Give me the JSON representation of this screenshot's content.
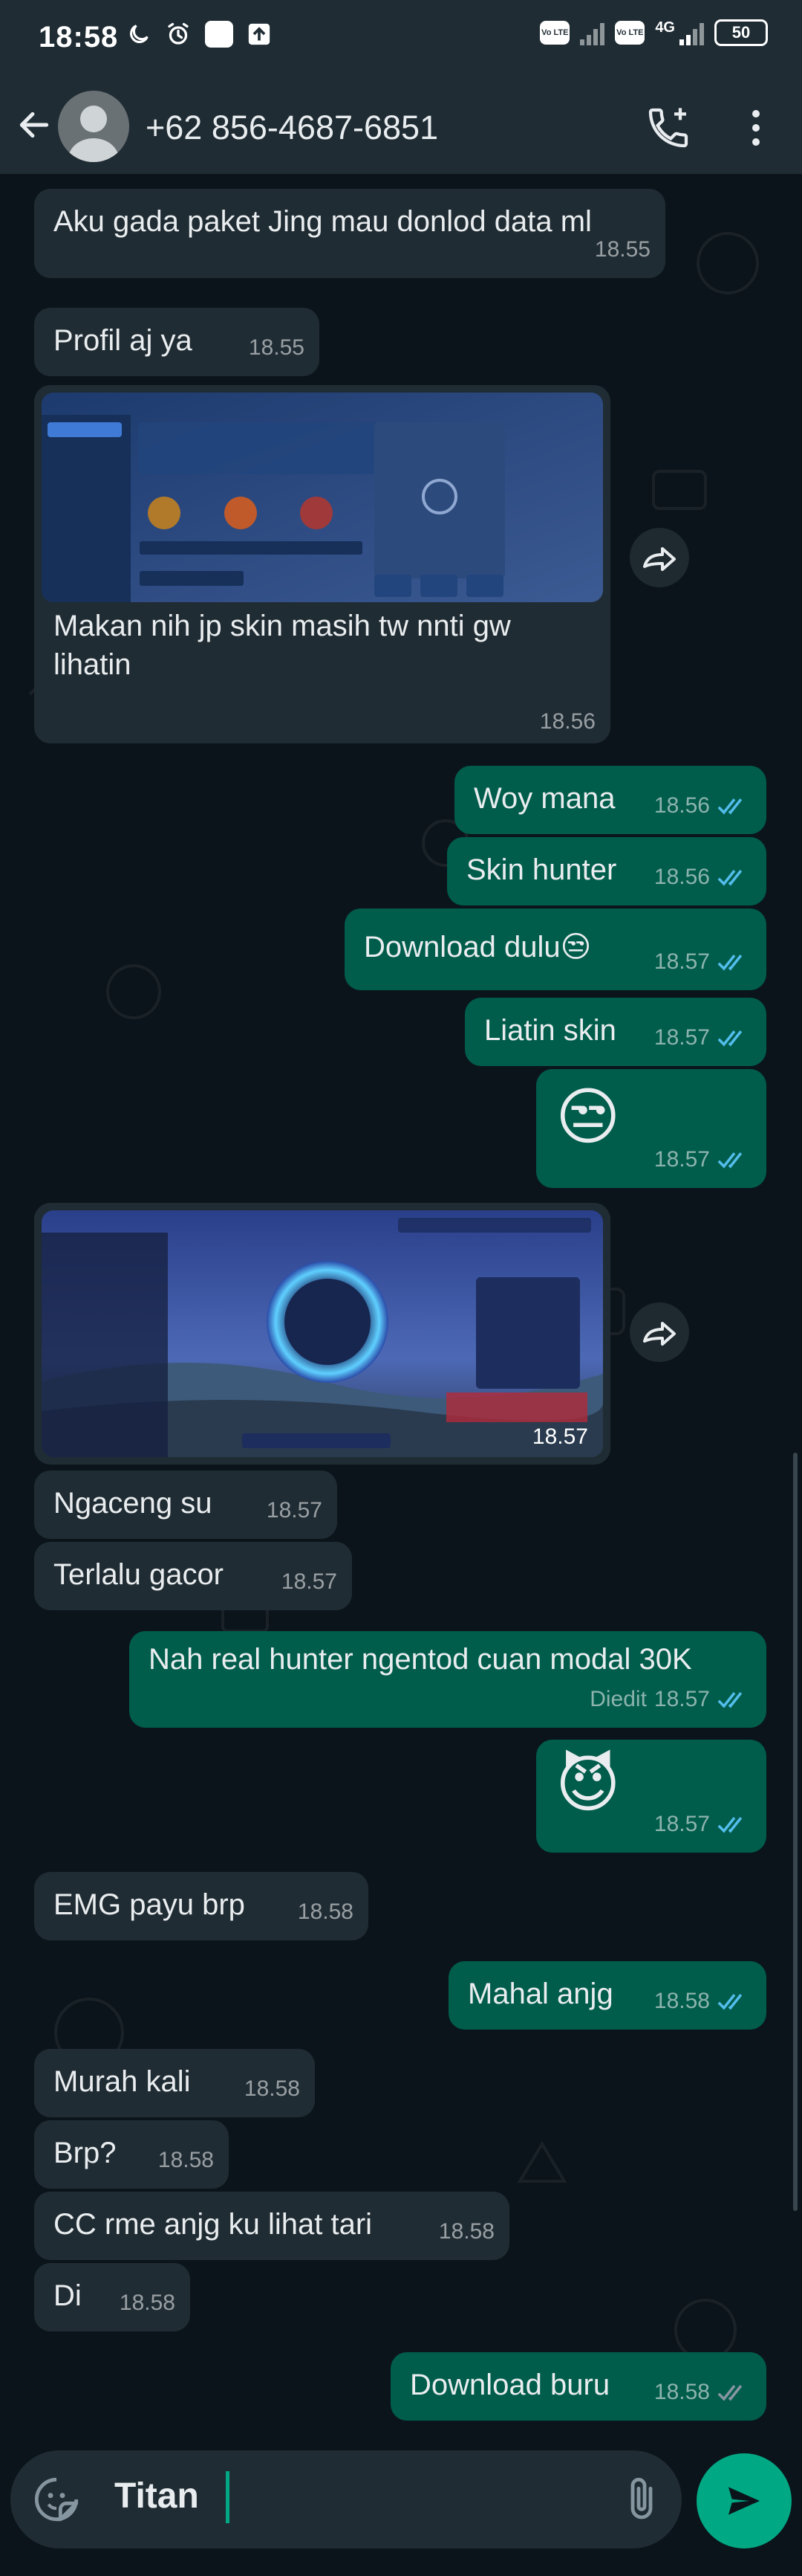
{
  "status_bar": {
    "time": "18:58",
    "network_label_1": "Vo LTE",
    "network_label_2": "Vo LTE",
    "network_type": "4G",
    "battery": "50"
  },
  "header": {
    "contact": "+62 856-4687-6851"
  },
  "messages": [
    {
      "dir": "in",
      "text": "Aku gada paket Jing mau donlod data ml",
      "time": "18.55"
    },
    {
      "dir": "in",
      "text": "Profil aj ya",
      "time": "18.55"
    },
    {
      "dir": "in",
      "type": "image",
      "caption_line1": "Makan nih jp skin masih tw nnti gw",
      "caption_line2": "lihatin",
      "time": "18.56"
    },
    {
      "dir": "out",
      "text": "Woy mana",
      "time": "18.56"
    },
    {
      "dir": "out",
      "text": "Skin hunter",
      "time": "18.56"
    },
    {
      "dir": "out",
      "text": "Download dulu😒",
      "time": "18.57"
    },
    {
      "dir": "out",
      "text": "Liatin skin",
      "time": "18.57"
    },
    {
      "dir": "out",
      "text": "😒",
      "time": "18.57"
    },
    {
      "dir": "in",
      "type": "image",
      "time": "18.57"
    },
    {
      "dir": "in",
      "text": "Ngaceng su",
      "time": "18.57"
    },
    {
      "dir": "in",
      "text": "Terlalu gacor",
      "time": "18.57"
    },
    {
      "dir": "out",
      "text": "Nah real hunter ngentod cuan modal 30K",
      "edited": "Diedit",
      "time": "18.57"
    },
    {
      "dir": "out",
      "text": "😈",
      "time": "18.57"
    },
    {
      "dir": "in",
      "text": "EMG payu brp",
      "time": "18.58"
    },
    {
      "dir": "out",
      "text": "Mahal anjg",
      "time": "18.58"
    },
    {
      "dir": "in",
      "text": "Murah kali",
      "time": "18.58"
    },
    {
      "dir": "in",
      "text": "Brp?",
      "time": "18.58"
    },
    {
      "dir": "in",
      "text": "CC rme anjg ku lihat tari",
      "time": "18.58"
    },
    {
      "dir": "in",
      "text": "Di",
      "time": "18.58"
    },
    {
      "dir": "out",
      "text": "Download buru",
      "time": "18.58"
    }
  ],
  "composer": {
    "value": "Titan"
  },
  "colors": {
    "bg": "#0b141a",
    "incoming": "#202c33",
    "outgoing": "#005c4b",
    "accent": "#00a884",
    "read_ticks": "#53bdeb"
  },
  "icons": [
    "back-arrow-icon",
    "avatar-placeholder-icon",
    "add-call-icon",
    "more-vert-icon",
    "forward-icon",
    "sticker-icon",
    "attach-icon",
    "send-icon",
    "double-check-icon"
  ]
}
